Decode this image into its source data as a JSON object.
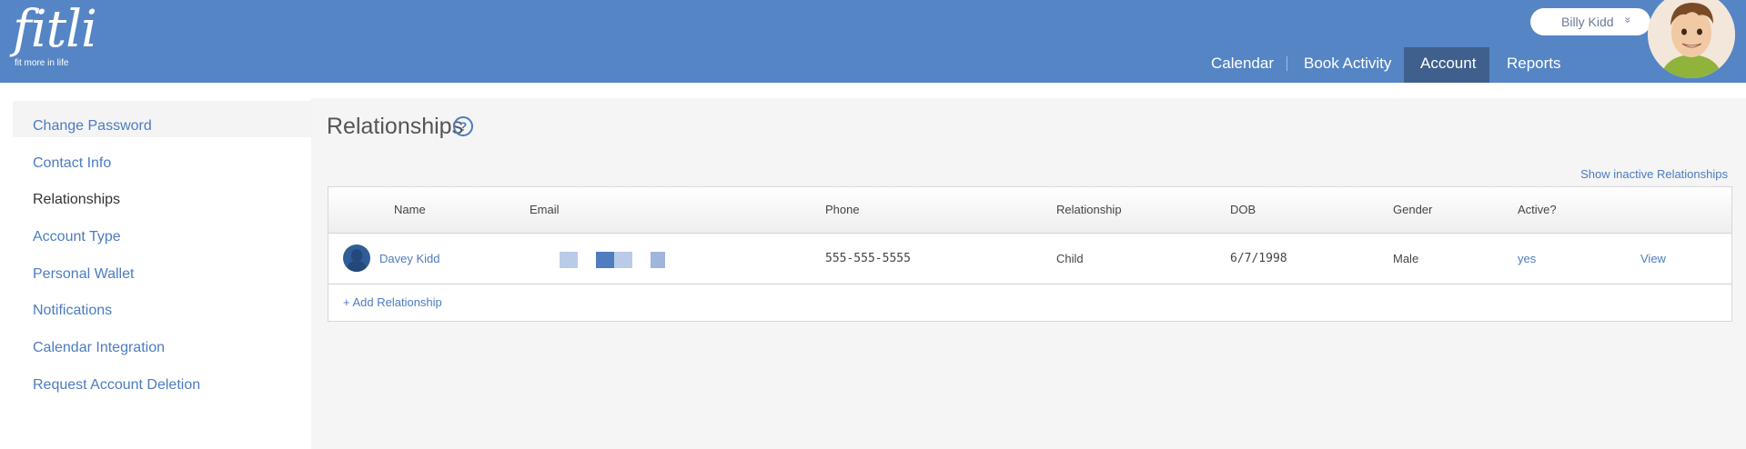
{
  "brand": {
    "logo_text": "fitli",
    "tagline": "fit more in life"
  },
  "user_menu": {
    "name": "Billy Kidd",
    "chevron": "»"
  },
  "nav": {
    "items": [
      {
        "label": "Calendar"
      },
      {
        "label": "Book Activity"
      },
      {
        "label": "Account",
        "active": true
      },
      {
        "label": "Reports"
      }
    ]
  },
  "sidebar": {
    "items": [
      {
        "label": "Change Password"
      },
      {
        "label": "Contact Info"
      },
      {
        "label": "Relationships",
        "active": true
      },
      {
        "label": "Account Type"
      },
      {
        "label": "Personal Wallet"
      },
      {
        "label": "Notifications"
      },
      {
        "label": "Calendar Integration"
      },
      {
        "label": "Request Account Deletion"
      }
    ]
  },
  "page": {
    "title": "Relationships",
    "help_icon": "?",
    "show_inactive": "Show inactive Relationships"
  },
  "table": {
    "headers": [
      "Name",
      "Email",
      "Phone",
      "Relationship",
      "DOB",
      "Gender",
      "Active?"
    ],
    "rows": [
      {
        "name": "Davey Kidd",
        "phone": "555-555-5555",
        "relationship": "Child",
        "dob": "6/7/1998",
        "gender": "Male",
        "active": "yes",
        "action": "View"
      }
    ],
    "add_label": "+ Add Relationship"
  },
  "colors": {
    "header_bg": "#5585c5",
    "nav_active_bg": "#3f5f8d",
    "link": "#4c7cbf"
  }
}
